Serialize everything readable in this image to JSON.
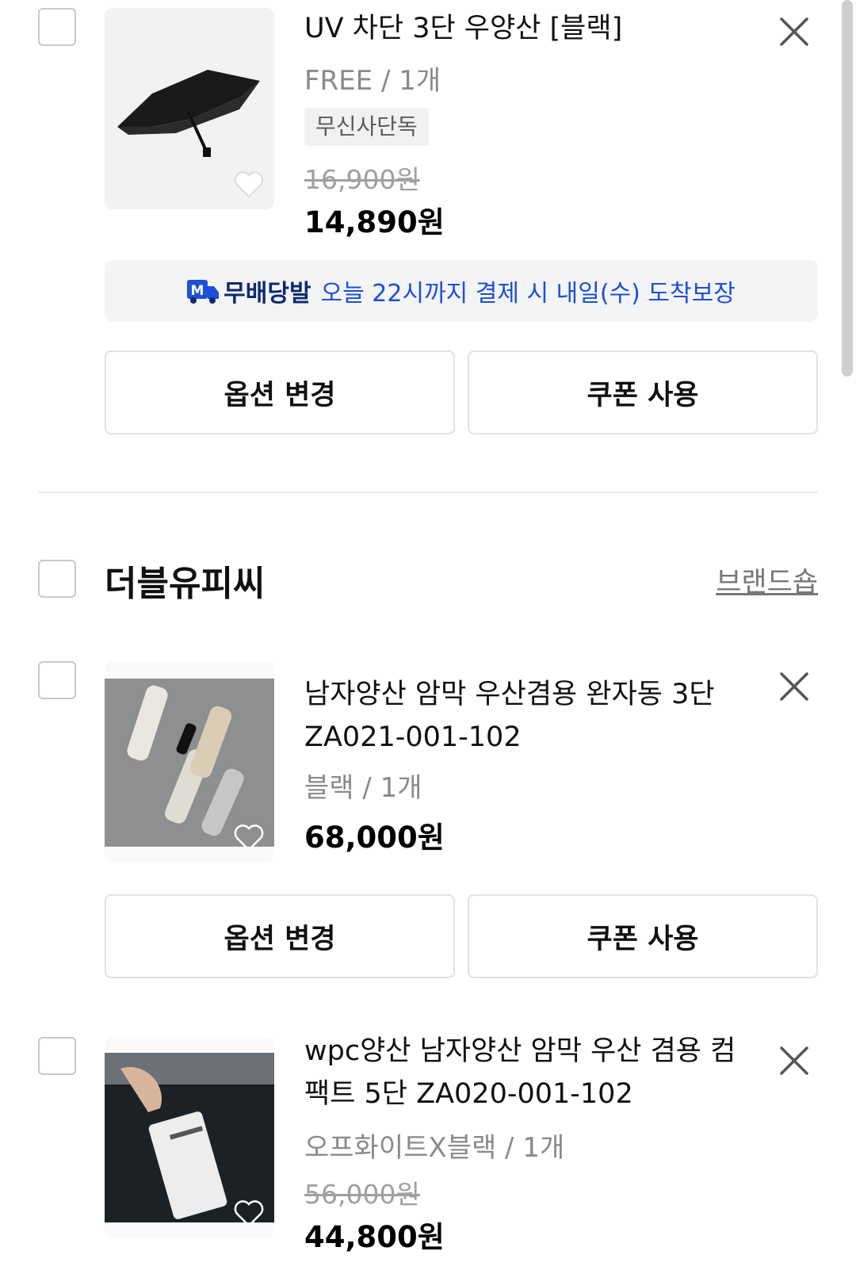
{
  "item1": {
    "name": "UV 차단 3단 우양산 [블랙]",
    "option": "FREE / 1개",
    "badge": "무신사단독",
    "original_price": "16,900원",
    "price": "14,890원"
  },
  "delivery": {
    "logo_letter": "M",
    "label": "무배당발",
    "message": "오늘 22시까지 결제 시 내일(수) 도착보장"
  },
  "buttons": {
    "change_option": "옵션 변경",
    "use_coupon": "쿠폰 사용"
  },
  "brand": {
    "name": "더블유피씨",
    "shop_link": "브랜드숍"
  },
  "item2": {
    "name_line1": "남자양산 암막 우산겸용 완자동 3단",
    "name_line2": "ZA021-001-102",
    "option": "블랙 / 1개",
    "price": "68,000원"
  },
  "item3": {
    "name_line1": "wpc양산 남자양산 암막 우산 겸용 컴",
    "name_line2": "팩트 5단 ZA020-001-102",
    "option": "오프화이트X블랙 / 1개",
    "original_price": "56,000원",
    "price": "44,800원"
  },
  "colors": {
    "delivery_blue": "#1d4fd8",
    "delivery_navy": "#0f2a6d",
    "muted_gray": "#8a8a8a"
  }
}
